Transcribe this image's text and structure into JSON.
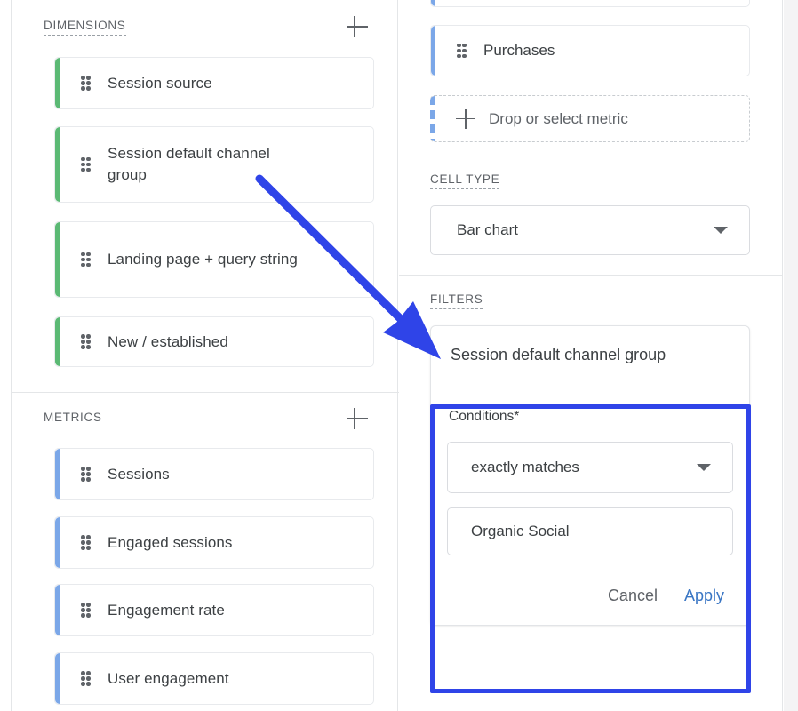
{
  "left_panel": {
    "dimensions": {
      "section_label": "DIMENSIONS",
      "add_icon": "plus-icon",
      "accent_color": "#5bb974",
      "items": [
        {
          "label": "Session source",
          "handle_icon": "drag-handle-icon"
        },
        {
          "label": "Session default channel group",
          "handle_icon": "drag-handle-icon"
        },
        {
          "label": "Landing page + query string",
          "handle_icon": "drag-handle-icon"
        },
        {
          "label": "New / established",
          "handle_icon": "drag-handle-icon"
        }
      ]
    },
    "metrics": {
      "section_label": "METRICS",
      "add_icon": "plus-icon",
      "accent_color": "#7ba7e8",
      "items": [
        {
          "label": "Sessions",
          "handle_icon": "drag-handle-icon"
        },
        {
          "label": "Engaged sessions",
          "handle_icon": "drag-handle-icon"
        },
        {
          "label": "Engagement rate",
          "handle_icon": "drag-handle-icon"
        },
        {
          "label": "User engagement",
          "handle_icon": "drag-handle-icon"
        }
      ]
    }
  },
  "right_panel": {
    "values": {
      "accent_color": "#7ba7e8",
      "items": [
        {
          "label": "Purchases",
          "handle_icon": "drag-handle-icon"
        }
      ],
      "drop_zone": {
        "label": "Drop or select metric",
        "plus_icon": "plus-icon"
      }
    },
    "cell_type": {
      "section_label": "CELL TYPE",
      "selected": "Bar chart",
      "caret_icon": "chevron-down-icon"
    },
    "filters": {
      "section_label": "FILTERS",
      "card": {
        "title": "Session default channel group",
        "conditions_label": "Conditions*",
        "match_type": {
          "selected": "exactly matches",
          "caret_icon": "chevron-down-icon"
        },
        "value": "Organic Social",
        "cancel_label": "Cancel",
        "apply_label": "Apply",
        "apply_color": "#3a76c4"
      }
    }
  },
  "annotations": {
    "arrow": {
      "icon": "arrow-pointer-icon",
      "color": "#2f44e8"
    },
    "highlight_rect": {
      "color": "#2f44e8"
    }
  }
}
